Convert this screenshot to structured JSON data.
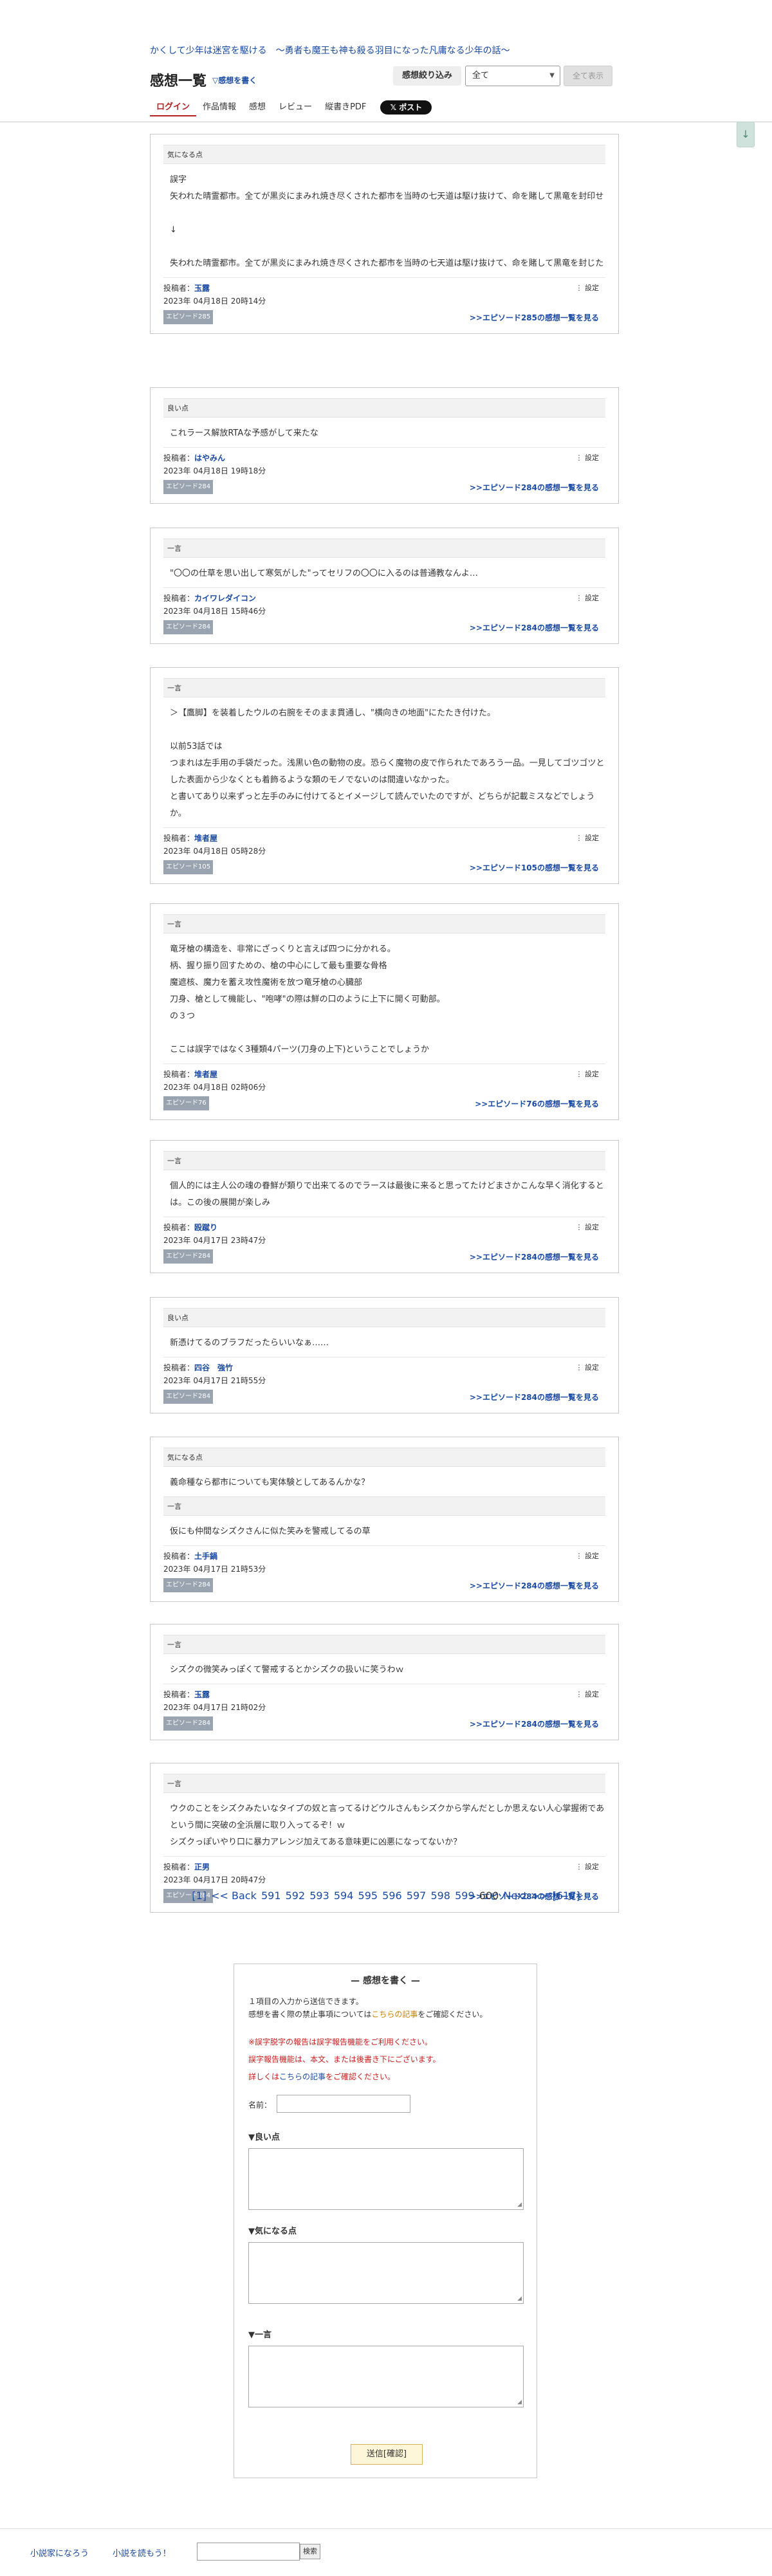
{
  "header": {
    "novel_title": "かくして少年は迷宮を駆ける　〜勇者も魔王も神も殺る羽目になった凡庸なる少年の話〜",
    "page_title": "感想一覧",
    "write_link_prefix": "▽",
    "write_link": "感想を書く",
    "filter_label": "感想絞り込み",
    "filter_value": "全て",
    "show_all_button": "全て表示",
    "nav": [
      "ログイン",
      "作品情報",
      "感想",
      "レビュー",
      "縦書きPDF"
    ],
    "post_button": "𝕏 ポスト",
    "scroll_down": "↓"
  },
  "common": {
    "poster_label": "投稿者：",
    "settings_label": "⋮ 設定"
  },
  "impressions": [
    {
      "sections": [
        {
          "head": "気になる点",
          "body": "誤字\n矢われた晴霊都市。全てが黒炎にまみれ焼き尽くされた都市を当時の七天道は駆け抜けて、命を賭して黒竜を封印せ\n\n↓\n\n失われた晴霊都市。全てが黒炎にまみれ焼き尽くされた都市を当時の七天道は駆け抜けて、命を賭して黒竜を封じた"
        }
      ],
      "poster": "玉露",
      "date": "2023年 04月18日 20時14分",
      "episode": "エピソード285",
      "more": ">>エピソード285の感想一覧を見る"
    },
    {
      "sections": [
        {
          "head": "良い点",
          "body": "これラース解放RTAな予感がして来たな"
        }
      ],
      "poster": "はやみん",
      "date": "2023年 04月18日 19時18分",
      "episode": "エピソード284",
      "more": ">>エピソード284の感想一覧を見る"
    },
    {
      "sections": [
        {
          "head": "一言",
          "body": "\"〇〇の仕草を思い出して寒気がした\"ってセリフの〇〇に入るのは普通教なんよ…"
        }
      ],
      "poster": "カイワレダイコン",
      "date": "2023年 04月18日 15時46分",
      "episode": "エピソード284",
      "more": ">>エピソード284の感想一覧を見る"
    },
    {
      "sections": [
        {
          "head": "一言",
          "body": "＞【鷹脚】を装着したウルの右腕をそのまま貫通し、\"横向きの地面\"にたたき付けた。\n\n以前53話では\nつまれは左手用の手袋だった。浅黒い色の動物の皮。恐らく魔物の皮で作られたであろう一品。一見してゴツゴツとした表面から少なくとも着飾るような類のモノでないのは間違いなかった。\nと書いてあり以来ずっと左手のみに付けてるとイメージして読んでいたのですが、どちらが記載ミスなどでしょうか。"
        }
      ],
      "poster": "堆者屋",
      "date": "2023年 04月18日 05時28分",
      "episode": "エピソード105",
      "more": ">>エピソード105の感想一覧を見る"
    },
    {
      "sections": [
        {
          "head": "一言",
          "body": "竜牙槍の構造を、非常にざっくりと言えば四つに分かれる。\n柄、握り振り回すための、槍の中心にして最も重要な骨格\n魔遮核、魔力を蓄え攻性魔術を放つ竜牙槍の心臓部\n刀身、槍として機能し、\"咆哮\"の際は鮮の口のように上下に開く可動部。\nの３つ\n\nここは誤字ではなく3種類4パーツ(刀身の上下)ということでしょうか"
        }
      ],
      "poster": "堆者屋",
      "date": "2023年 04月18日 02時06分",
      "episode": "エピソード76",
      "more": ">>エピソード76の感想一覧を見る"
    },
    {
      "sections": [
        {
          "head": "一言",
          "body": "個人的には主人公の魂の眷鮮が類りで出来てるのでラースは最後に来ると思ってたけどまさかこんな早く消化するとは。この後の展開が楽しみ"
        }
      ],
      "poster": "殴蹴り",
      "date": "2023年 04月17日 23時47分",
      "episode": "エピソード284",
      "more": ">>エピソード284の感想一覧を見る"
    },
    {
      "sections": [
        {
          "head": "良い点",
          "body": "新憑けてるのブラフだったらいいなぁ……"
        }
      ],
      "poster": "四谷　強竹",
      "date": "2023年 04月17日 21時55分",
      "episode": "エピソード284",
      "more": ">>エピソード284の感想一覧を見る"
    },
    {
      "sections": [
        {
          "head": "気になる点",
          "body": "義命種なら都市についても実体験としてあるんかな？"
        },
        {
          "head": "一言",
          "body": "仮にも仲間なシズクさんに似た笑みを警戒してるの草"
        }
      ],
      "poster": "土手鍋",
      "date": "2023年 04月17日 21時53分",
      "episode": "エピソード284",
      "more": ">>エピソード284の感想一覧を見る"
    },
    {
      "sections": [
        {
          "head": "一言",
          "body": "シズクの微笑みっぽくて警戒するとかシズクの扱いに笑うわｗ"
        }
      ],
      "poster": "玉露",
      "date": "2023年 04月17日 21時02分",
      "episode": "エピソード284",
      "more": ">>エピソード284の感想一覧を見る"
    },
    {
      "sections": [
        {
          "head": "一言",
          "body": "ウクのことをシズクみたいなタイプの奴と言ってるけどウルさんもシズクから学んだとしか思えない人心掌握術であという間に突破の全浜層に取り入ってるぞ！ｗ\nシズクっぽいやり口に暴力アレンジ加えてある意味更に凶悪になってないか？"
        }
      ],
      "poster": "正男",
      "date": "2023年 04月17日 20時47分",
      "episode": "エピソード284",
      "more": ">>エピソード284の感想一覧を見る"
    }
  ],
  "pagination": {
    "first": "[1]",
    "back": "<< Back",
    "pages": [
      "591",
      "592",
      "593",
      "594",
      "595",
      "596",
      "597",
      "598",
      "599"
    ],
    "current": "600",
    "next": "Next >>",
    "last": "[617]"
  },
  "form": {
    "title": "— 感想を書く —",
    "note_line1": "１項目の入力から送信できます。",
    "note_line2_pre": "感想を書く際の禁止事項については",
    "note_line2_link": "こちらの記事",
    "note_line2_post": "をご確認ください。",
    "warn_line1": "※誤字脱字の報告は誤字報告機能をご利用ください。",
    "warn_line2": "誤字報告機能は、本文、または後書き下にございます。",
    "warn_line3_pre": "詳しくは",
    "warn_line3_link": "こちらの記事",
    "warn_line3_post": "をご確認ください。",
    "name_label": "名前：",
    "good_label": "▼良い点",
    "concern_label": "▼気になる点",
    "comment_label": "▼一言",
    "submit": "送信[確認]"
  },
  "footer": {
    "link1": "小説家になろう",
    "link2": "小説を読もう！",
    "search_button": "検索"
  }
}
